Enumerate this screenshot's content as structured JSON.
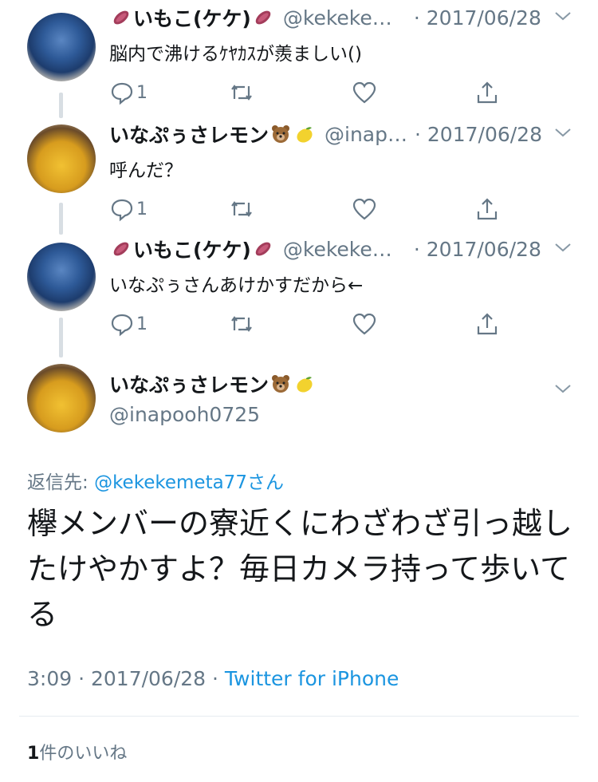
{
  "thread": [
    {
      "avatar": "imoko-avatar",
      "name": "いもこ(ケケ)",
      "name_emoji_left": "sweet-potato-icon",
      "name_emoji_right": "sweet-potato-icon",
      "handle": "@kekekeme...",
      "date": "· 2017/06/28",
      "text": "脳内で沸けるｹﾔｶｽが羨ましい()",
      "reply_count": "1"
    },
    {
      "avatar": "inapoo-avatar",
      "name": "いなぷぅさレモン",
      "name_emoji_right": [
        "bear-face-icon",
        "lemon-icon"
      ],
      "handle": "@inapo...",
      "date": "· 2017/06/28",
      "text": "呼んだ？",
      "reply_count": "1"
    },
    {
      "avatar": "imoko-avatar",
      "name": "いもこ(ケケ)",
      "name_emoji_left": "sweet-potato-icon",
      "name_emoji_right": "sweet-potato-icon",
      "handle": "@kekekeme...",
      "date": "· 2017/06/28",
      "text": "いなぷぅさんあけかすだから←",
      "reply_count": "1"
    }
  ],
  "main": {
    "name": "いなぷぅさレモン",
    "handle": "@inapooh0725",
    "reply_prefix": "返信先: ",
    "reply_target": "@kekekemeta77さん",
    "text": "欅メンバーの寮近くにわざわざ引っ越したけやかすよ？毎日カメラ持って歩いてる",
    "time": "3:09 · 2017/06/28 · ",
    "source": "Twitter for iPhone",
    "likes_count": "1",
    "likes_label": "件のいいね"
  },
  "colors": {
    "link": "#1b95e0",
    "secondary": "#657786",
    "text": "#14171a",
    "thread_line": "#d8dee3"
  }
}
